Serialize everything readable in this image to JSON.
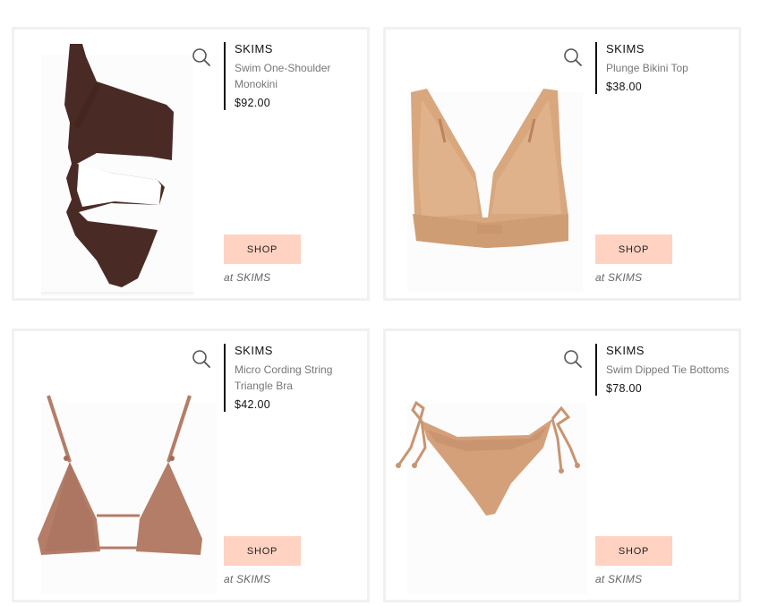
{
  "products": [
    {
      "brand": "SKIMS",
      "name": "Swim One-Shoulder Monokini",
      "price": "$92.00",
      "shop_label": "SHOP",
      "store_prefix": "at",
      "store": "SKIMS",
      "image_color": "#4a2a24"
    },
    {
      "brand": "SKIMS",
      "name": "Plunge Bikini Top",
      "price": "$38.00",
      "shop_label": "SHOP",
      "store_prefix": "at",
      "store": "SKIMS",
      "image_color": "#d8a77e"
    },
    {
      "brand": "SKIMS",
      "name": "Micro Cording String Triangle Bra",
      "price": "$42.00",
      "shop_label": "SHOP",
      "store_prefix": "at",
      "store": "SKIMS",
      "image_color": "#b47d68"
    },
    {
      "brand": "SKIMS",
      "name": "Swim Dipped Tie Bottoms",
      "price": "$78.00",
      "shop_label": "SHOP",
      "store_prefix": "at",
      "store": "SKIMS",
      "image_color": "#d4a07a"
    }
  ],
  "icons": {
    "zoom": "search-icon"
  },
  "colors": {
    "shop_button": "#ffd2c2",
    "card_border": "#f1f1f1",
    "info_rule": "#111111"
  }
}
